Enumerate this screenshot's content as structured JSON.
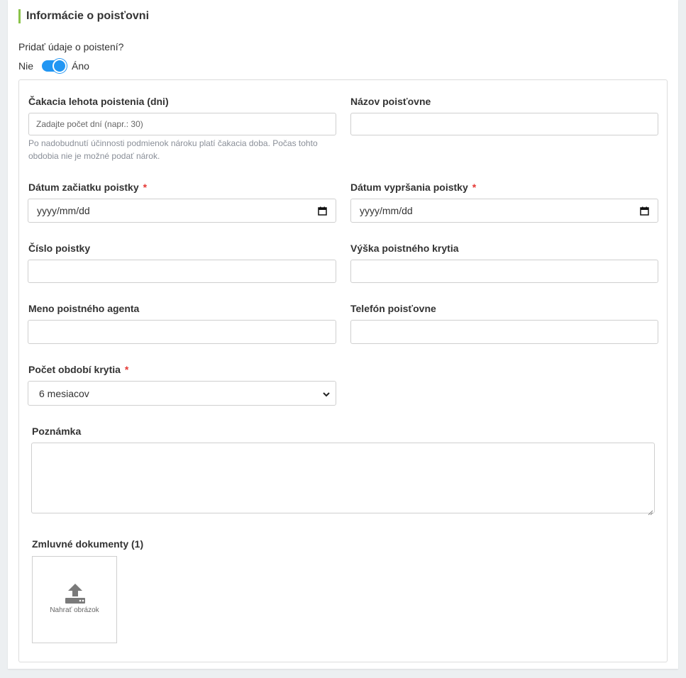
{
  "section": {
    "title": "Informácie o poisťovni"
  },
  "toggle": {
    "question": "Pridať údaje o poistení?",
    "off_label": "Nie",
    "on_label": "Áno",
    "state": "on"
  },
  "fields": {
    "waiting_period": {
      "label": "Čakacia lehota poistenia (dni)",
      "placeholder": "Zadajte počet dní (napr.: 30)",
      "value": "",
      "help": "Po nadobudnutí účinnosti podmienok nároku platí čakacia doba. Počas tohto obdobia nie je možné podať nárok."
    },
    "insurer_name": {
      "label": "Názov poisťovne",
      "value": ""
    },
    "start_date": {
      "label": "Dátum začiatku poistky",
      "required_mark": "*",
      "value": "yyyy/mm/dd"
    },
    "end_date": {
      "label": "Dátum vypršania poistky",
      "required_mark": "*",
      "value": "yyyy/mm/dd"
    },
    "policy_number": {
      "label": "Číslo poistky",
      "value": ""
    },
    "coverage_amount": {
      "label": "Výška poistného krytia",
      "value": ""
    },
    "agent_name": {
      "label": "Meno poistného agenta",
      "value": ""
    },
    "insurer_phone": {
      "label": "Telefón poisťovne",
      "value": ""
    },
    "coverage_periods": {
      "label": "Počet období krytia",
      "required_mark": "*",
      "value": "6 mesiacov"
    },
    "note": {
      "label": "Poznámka",
      "value": ""
    },
    "documents": {
      "label": "Zmluvné dokumenty (1)",
      "upload_label": "Nahrať obrázok"
    }
  },
  "icons": {
    "calendar": "calendar-icon",
    "dropdown": "chevron-down-icon",
    "upload": "upload-icon"
  },
  "colors": {
    "accent": "#2196f3",
    "section_bar": "#8bc34a",
    "required": "#e53935"
  }
}
